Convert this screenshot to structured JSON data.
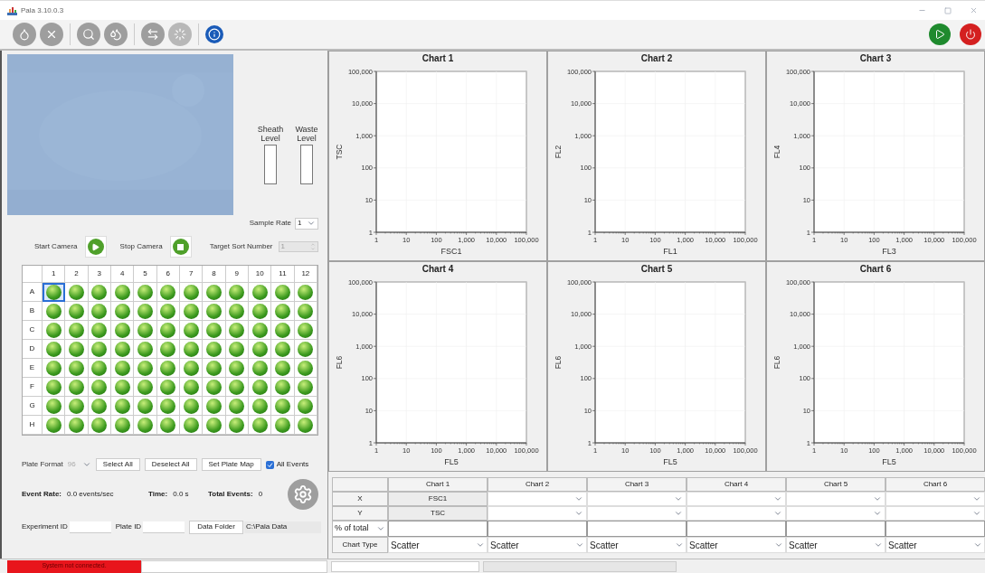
{
  "window": {
    "title": "Pala 3.10.0.3"
  },
  "camera": {
    "sheath": {
      "label": "Sheath Level",
      "level": 0
    },
    "waste": {
      "label": "Waste Level",
      "level": 0
    },
    "sample_rate": {
      "label": "Sample Rate",
      "value": "1"
    },
    "start_label": "Start Camera",
    "stop_label": "Stop Camera",
    "target_sort": {
      "label": "Target Sort Number",
      "value": "1",
      "disabled": true
    }
  },
  "plate": {
    "columns": [
      "1",
      "2",
      "3",
      "4",
      "5",
      "6",
      "7",
      "8",
      "9",
      "10",
      "11",
      "12"
    ],
    "rows": [
      {
        "label": "A",
        "wells": [
          {
            "selected": true
          },
          {
            "selected": false
          },
          {
            "selected": false
          },
          {
            "selected": false
          },
          {
            "selected": false
          },
          {
            "selected": false
          },
          {
            "selected": false
          },
          {
            "selected": false
          },
          {
            "selected": false
          },
          {
            "selected": false
          },
          {
            "selected": false
          },
          {
            "selected": false
          }
        ]
      },
      {
        "label": "B",
        "wells": [
          {
            "selected": false
          },
          {
            "selected": false
          },
          {
            "selected": false
          },
          {
            "selected": false
          },
          {
            "selected": false
          },
          {
            "selected": false
          },
          {
            "selected": false
          },
          {
            "selected": false
          },
          {
            "selected": false
          },
          {
            "selected": false
          },
          {
            "selected": false
          },
          {
            "selected": false
          }
        ]
      },
      {
        "label": "C",
        "wells": [
          {
            "selected": false
          },
          {
            "selected": false
          },
          {
            "selected": false
          },
          {
            "selected": false
          },
          {
            "selected": false
          },
          {
            "selected": false
          },
          {
            "selected": false
          },
          {
            "selected": false
          },
          {
            "selected": false
          },
          {
            "selected": false
          },
          {
            "selected": false
          },
          {
            "selected": false
          }
        ]
      },
      {
        "label": "D",
        "wells": [
          {
            "selected": false
          },
          {
            "selected": false
          },
          {
            "selected": false
          },
          {
            "selected": false
          },
          {
            "selected": false
          },
          {
            "selected": false
          },
          {
            "selected": false
          },
          {
            "selected": false
          },
          {
            "selected": false
          },
          {
            "selected": false
          },
          {
            "selected": false
          },
          {
            "selected": false
          }
        ]
      },
      {
        "label": "E",
        "wells": [
          {
            "selected": false
          },
          {
            "selected": false
          },
          {
            "selected": false
          },
          {
            "selected": false
          },
          {
            "selected": false
          },
          {
            "selected": false
          },
          {
            "selected": false
          },
          {
            "selected": false
          },
          {
            "selected": false
          },
          {
            "selected": false
          },
          {
            "selected": false
          },
          {
            "selected": false
          }
        ]
      },
      {
        "label": "F",
        "wells": [
          {
            "selected": false
          },
          {
            "selected": false
          },
          {
            "selected": false
          },
          {
            "selected": false
          },
          {
            "selected": false
          },
          {
            "selected": false
          },
          {
            "selected": false
          },
          {
            "selected": false
          },
          {
            "selected": false
          },
          {
            "selected": false
          },
          {
            "selected": false
          },
          {
            "selected": false
          }
        ]
      },
      {
        "label": "G",
        "wells": [
          {
            "selected": false
          },
          {
            "selected": false
          },
          {
            "selected": false
          },
          {
            "selected": false
          },
          {
            "selected": false
          },
          {
            "selected": false
          },
          {
            "selected": false
          },
          {
            "selected": false
          },
          {
            "selected": false
          },
          {
            "selected": false
          },
          {
            "selected": false
          },
          {
            "selected": false
          }
        ]
      },
      {
        "label": "H",
        "wells": [
          {
            "selected": false
          },
          {
            "selected": false
          },
          {
            "selected": false
          },
          {
            "selected": false
          },
          {
            "selected": false
          },
          {
            "selected": false
          },
          {
            "selected": false
          },
          {
            "selected": false
          },
          {
            "selected": false
          },
          {
            "selected": false
          },
          {
            "selected": false
          },
          {
            "selected": false
          }
        ]
      }
    ]
  },
  "plate_controls": {
    "format": {
      "label": "Plate Format",
      "value": "96",
      "disabled": true
    },
    "buttons": [
      "Select All",
      "Deselect All",
      "Set Plate Map"
    ],
    "all_events": {
      "label": "All Events",
      "checked": true
    }
  },
  "stats": [
    {
      "label": "Event Rate:",
      "value": "0.0 events/sec"
    },
    {
      "label": "Time:",
      "value": "0.0 s"
    },
    {
      "label": "Total Events:",
      "value": "0"
    }
  ],
  "experiment": {
    "experiment_id_label": "Experiment ID",
    "plate_id_label": "Plate ID",
    "data_folder_button": "Data Folder",
    "data_folder_path": "C:\\Pala Data"
  },
  "charts": [
    {
      "title": "Chart 1",
      "y_tick_labels": [
        "100,000",
        "10,000",
        "1,000",
        "100",
        "10",
        "1"
      ],
      "y_axis_title": "TSC",
      "x_tick_labels": [
        "1",
        "10",
        "100",
        "1,000",
        "10,000",
        "100,000"
      ],
      "x_axis_title": "FSC1"
    },
    {
      "title": "Chart 2",
      "y_tick_labels": [
        "100,000",
        "10,000",
        "1,000",
        "100",
        "10",
        "1"
      ],
      "y_axis_title": "FL2",
      "x_tick_labels": [
        "1",
        "10",
        "100",
        "1,000",
        "10,000",
        "100,000"
      ],
      "x_axis_title": "FL1"
    },
    {
      "title": "Chart 3",
      "y_tick_labels": [
        "100,000",
        "10,000",
        "1,000",
        "100",
        "10",
        "1"
      ],
      "y_axis_title": "FL4",
      "x_tick_labels": [
        "1",
        "10",
        "100",
        "1,000",
        "10,000",
        "100,000"
      ],
      "x_axis_title": "FL3"
    },
    {
      "title": "Chart 4",
      "y_tick_labels": [
        "100,000",
        "10,000",
        "1,000",
        "100",
        "10",
        "1"
      ],
      "y_axis_title": "FL6",
      "x_tick_labels": [
        "1",
        "10",
        "100",
        "1,000",
        "10,000",
        "100,000"
      ],
      "x_axis_title": "FL5"
    },
    {
      "title": "Chart 5",
      "y_tick_labels": [
        "100,000",
        "10,000",
        "1,000",
        "100",
        "10",
        "1"
      ],
      "y_axis_title": "FL6",
      "x_tick_labels": [
        "1",
        "10",
        "100",
        "1,000",
        "10,000",
        "100,000"
      ],
      "x_axis_title": "FL5"
    },
    {
      "title": "Chart 6",
      "y_tick_labels": [
        "100,000",
        "10,000",
        "1,000",
        "100",
        "10",
        "1"
      ],
      "y_axis_title": "FL6",
      "x_tick_labels": [
        "1",
        "10",
        "100",
        "1,000",
        "10,000",
        "100,000"
      ],
      "x_axis_title": "FL5"
    }
  ],
  "chart_settings": {
    "row_labels": {
      "x": "X",
      "y": "Y",
      "percent": "% of total",
      "chart_type": "Chart Type"
    },
    "columns": [
      {
        "header": "Chart 1",
        "locked": true,
        "x": "FSC1",
        "y": "TSC",
        "chart_type": "Scatter"
      },
      {
        "header": "Chart 2",
        "locked": false,
        "chart_type": "Scatter"
      },
      {
        "header": "Chart 3",
        "locked": false,
        "chart_type": "Scatter"
      },
      {
        "header": "Chart 4",
        "locked": false,
        "chart_type": "Scatter"
      },
      {
        "header": "Chart 5",
        "locked": false,
        "chart_type": "Scatter"
      },
      {
        "header": "Chart 6",
        "locked": false,
        "chart_type": "Scatter"
      }
    ]
  },
  "status_bar": {
    "message": "System not connected.",
    "error": true
  }
}
